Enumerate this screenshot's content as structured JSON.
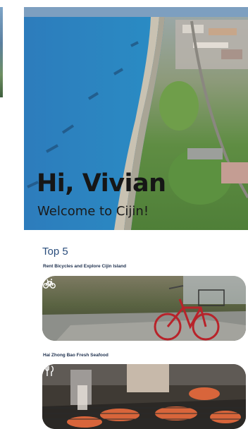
{
  "greeting": {
    "title": "Hi, Vivian",
    "subtitle": "Welcome to Cijin!"
  },
  "section": {
    "title": "Top 5"
  },
  "cards": [
    {
      "label": "Rent Bicycles and Explore Cijin Island",
      "icon": "bicycle-icon"
    },
    {
      "label": "Hai Zhong Bao Fresh Seafood",
      "icon": "utensils-icon"
    }
  ]
}
